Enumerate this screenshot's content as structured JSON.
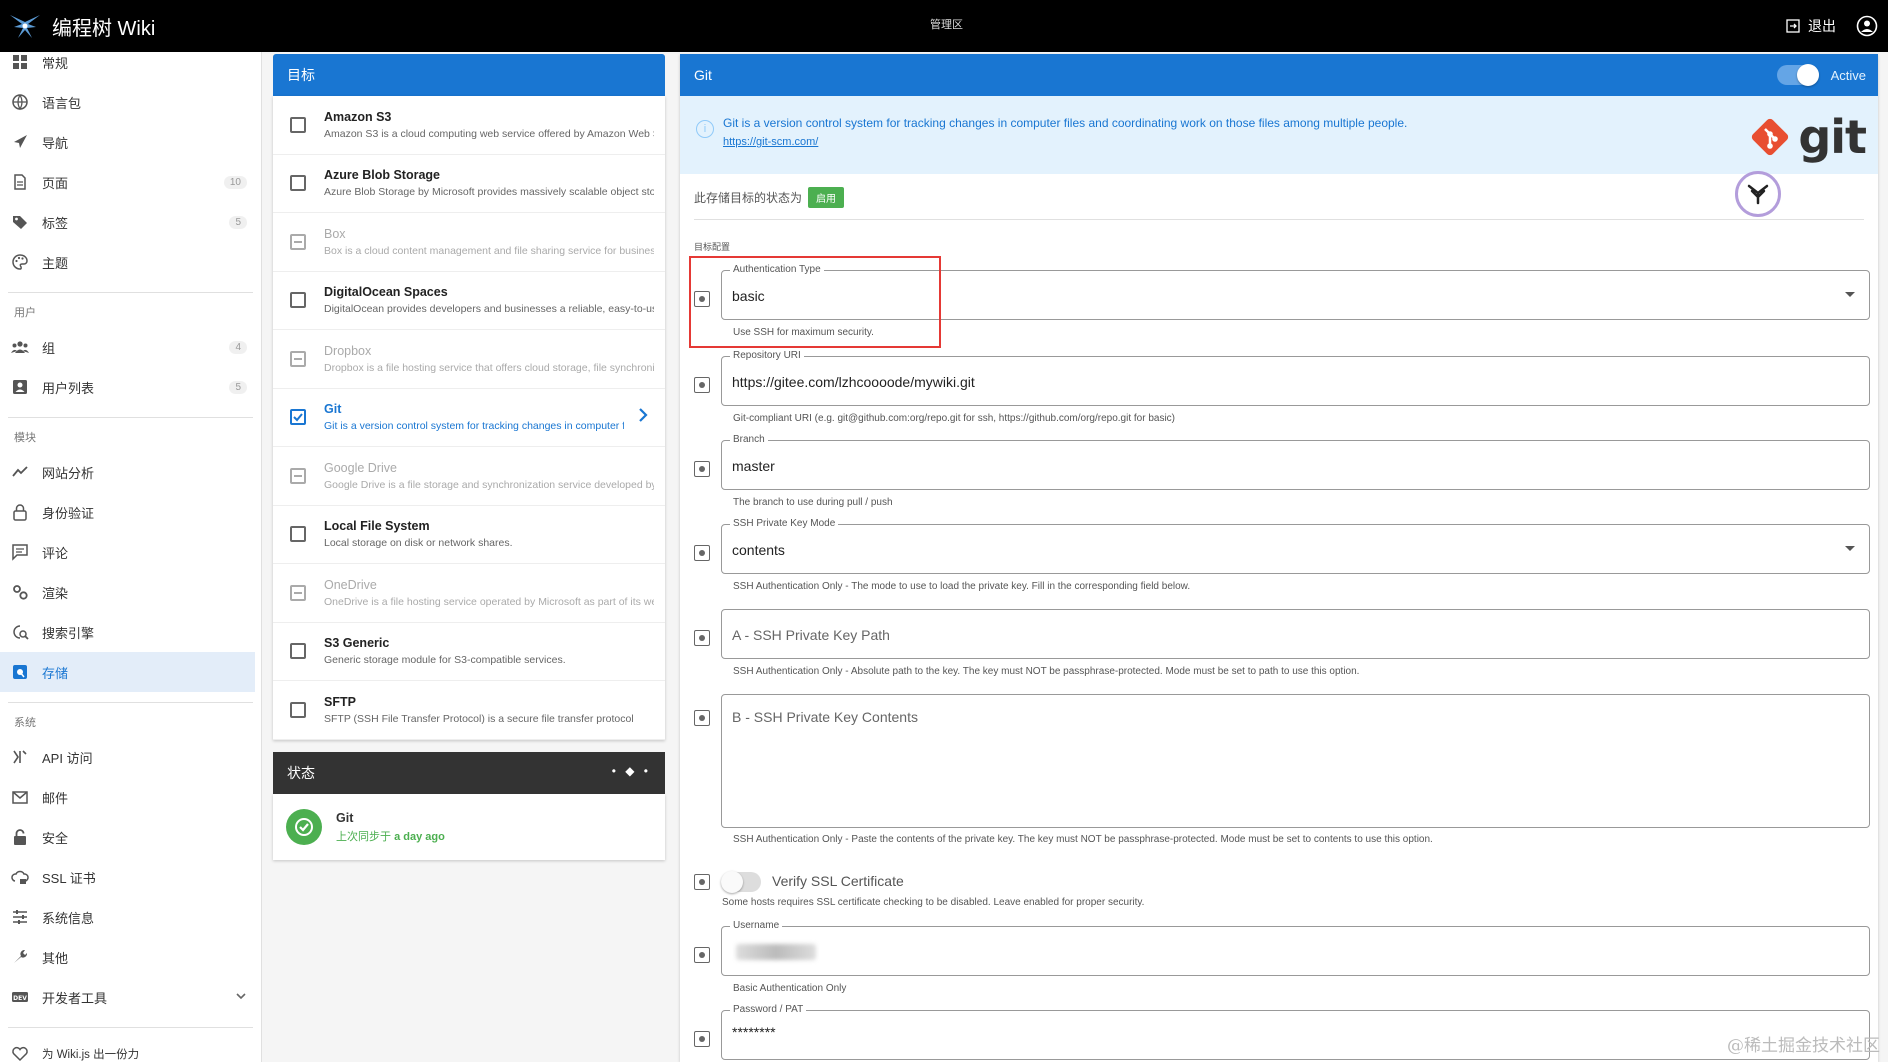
{
  "app": {
    "title": "编程树 Wiki",
    "center_label": "管理区",
    "logout_label": "退出"
  },
  "sidebar": {
    "items_top": [
      {
        "label": "常规",
        "icon": "dashboard-icon"
      },
      {
        "label": "语言包",
        "icon": "globe-icon"
      },
      {
        "label": "导航",
        "icon": "navigation-icon"
      },
      {
        "label": "页面",
        "icon": "page-icon",
        "count": "10"
      },
      {
        "label": "标签",
        "icon": "tags-icon",
        "count": "5"
      },
      {
        "label": "主题",
        "icon": "palette-icon"
      }
    ],
    "section_users": "用户",
    "items_users": [
      {
        "label": "组",
        "icon": "group-icon",
        "count": "4"
      },
      {
        "label": "用户列表",
        "icon": "user-icon",
        "count": "5"
      }
    ],
    "section_modules": "模块",
    "items_modules": [
      {
        "label": "网站分析",
        "icon": "analytics-icon"
      },
      {
        "label": "身份验证",
        "icon": "lock-icon"
      },
      {
        "label": "评论",
        "icon": "comment-icon"
      },
      {
        "label": "渲染",
        "icon": "cogs-icon"
      },
      {
        "label": "搜索引擎",
        "icon": "search-engine-icon"
      },
      {
        "label": "存储",
        "icon": "storage-icon",
        "active": true
      }
    ],
    "section_system": "系统",
    "items_system": [
      {
        "label": "API 访问",
        "icon": "api-icon"
      },
      {
        "label": "邮件",
        "icon": "mail-icon"
      },
      {
        "label": "安全",
        "icon": "security-icon"
      },
      {
        "label": "SSL 证书",
        "icon": "cloud-lock-icon"
      },
      {
        "label": "系统信息",
        "icon": "sliders-icon"
      },
      {
        "label": "其他",
        "icon": "wrench-icon"
      },
      {
        "label": "开发者工具",
        "icon": "dev-icon"
      }
    ],
    "contribute": "为 Wiki.js 出一份力"
  },
  "targets": {
    "header": "目标",
    "items": [
      {
        "title": "Amazon S3",
        "desc": "Amazon S3 is a cloud computing web service offered by Amazon Web Services",
        "state": "normal"
      },
      {
        "title": "Azure Blob Storage",
        "desc": "Azure Blob Storage by Microsoft provides massively scalable object storage",
        "state": "normal"
      },
      {
        "title": "Box",
        "desc": "Box is a cloud content management and file sharing service for businesses",
        "state": "disabled"
      },
      {
        "title": "DigitalOcean Spaces",
        "desc": "DigitalOcean provides developers and businesses a reliable, easy-to-use",
        "state": "normal"
      },
      {
        "title": "Dropbox",
        "desc": "Dropbox is a file hosting service that offers cloud storage, file synchronization",
        "state": "disabled"
      },
      {
        "title": "Git",
        "desc": "Git is a version control system for tracking changes in computer files",
        "state": "selected"
      },
      {
        "title": "Google Drive",
        "desc": "Google Drive is a file storage and synchronization service developed by Google",
        "state": "disabled"
      },
      {
        "title": "Local File System",
        "desc": "Local storage on disk or network shares.",
        "state": "normal"
      },
      {
        "title": "OneDrive",
        "desc": "OneDrive is a file hosting service operated by Microsoft as part of its web version",
        "state": "disabled"
      },
      {
        "title": "S3 Generic",
        "desc": "Generic storage module for S3-compatible services.",
        "state": "normal"
      },
      {
        "title": "SFTP",
        "desc": "SFTP (SSH File Transfer Protocol) is a secure file transfer protocol",
        "state": "normal"
      }
    ]
  },
  "status": {
    "header": "状态",
    "dots": "• ◆ •",
    "name": "Git",
    "sub_prefix": "上次同步于",
    "sub_time": "a day ago"
  },
  "git": {
    "header": "Git",
    "active_label": "Active",
    "info_text": "Git is a version control system for tracking changes in computer files and coordinating work on those files among multiple people.",
    "info_link": "https://git-scm.com/",
    "logo_word": "git",
    "state_prefix": "此存储目标的状态为",
    "state_badge": "启用",
    "section_label": "目标配置",
    "fields": {
      "auth": {
        "legend": "Authentication Type",
        "value": "basic",
        "hint": "Use SSH for maximum security."
      },
      "repo": {
        "legend": "Repository URI",
        "value": "https://gitee.com/lzhcoooode/mywiki.git",
        "hint": "Git-compliant URI (e.g. git@github.com:org/repo.git for ssh, https://github.com/org/repo.git for basic)"
      },
      "branch": {
        "legend": "Branch",
        "value": "master",
        "hint": "The branch to use during pull / push"
      },
      "sshmode": {
        "legend": "SSH Private Key Mode",
        "value": "contents",
        "hint": "SSH Authentication Only - The mode to use to load the private key. Fill in the corresponding field below."
      },
      "sshpath": {
        "placeholder": "A - SSH Private Key Path",
        "hint": "SSH Authentication Only - Absolute path to the key. The key must NOT be passphrase-protected. Mode must be set to path to use this option."
      },
      "sshcontents": {
        "placeholder": "B - SSH Private Key Contents",
        "hint": "SSH Authentication Only - Paste the contents of the private key. The key must NOT be passphrase-protected. Mode must be set to contents to use this option."
      },
      "verifyssl": {
        "label": "Verify SSL Certificate",
        "hint": "Some hosts requires SSL certificate checking to be disabled. Leave enabled for proper security."
      },
      "username": {
        "legend": "Username",
        "hint": "Basic Authentication Only"
      },
      "password": {
        "legend": "Password / PAT",
        "value": "********"
      }
    }
  },
  "watermark": "@稀土掘金技术社区",
  "colors": {
    "primary": "#1976d2",
    "success": "#4caf50",
    "highlight": "#e53935",
    "topbar": "#000000"
  }
}
